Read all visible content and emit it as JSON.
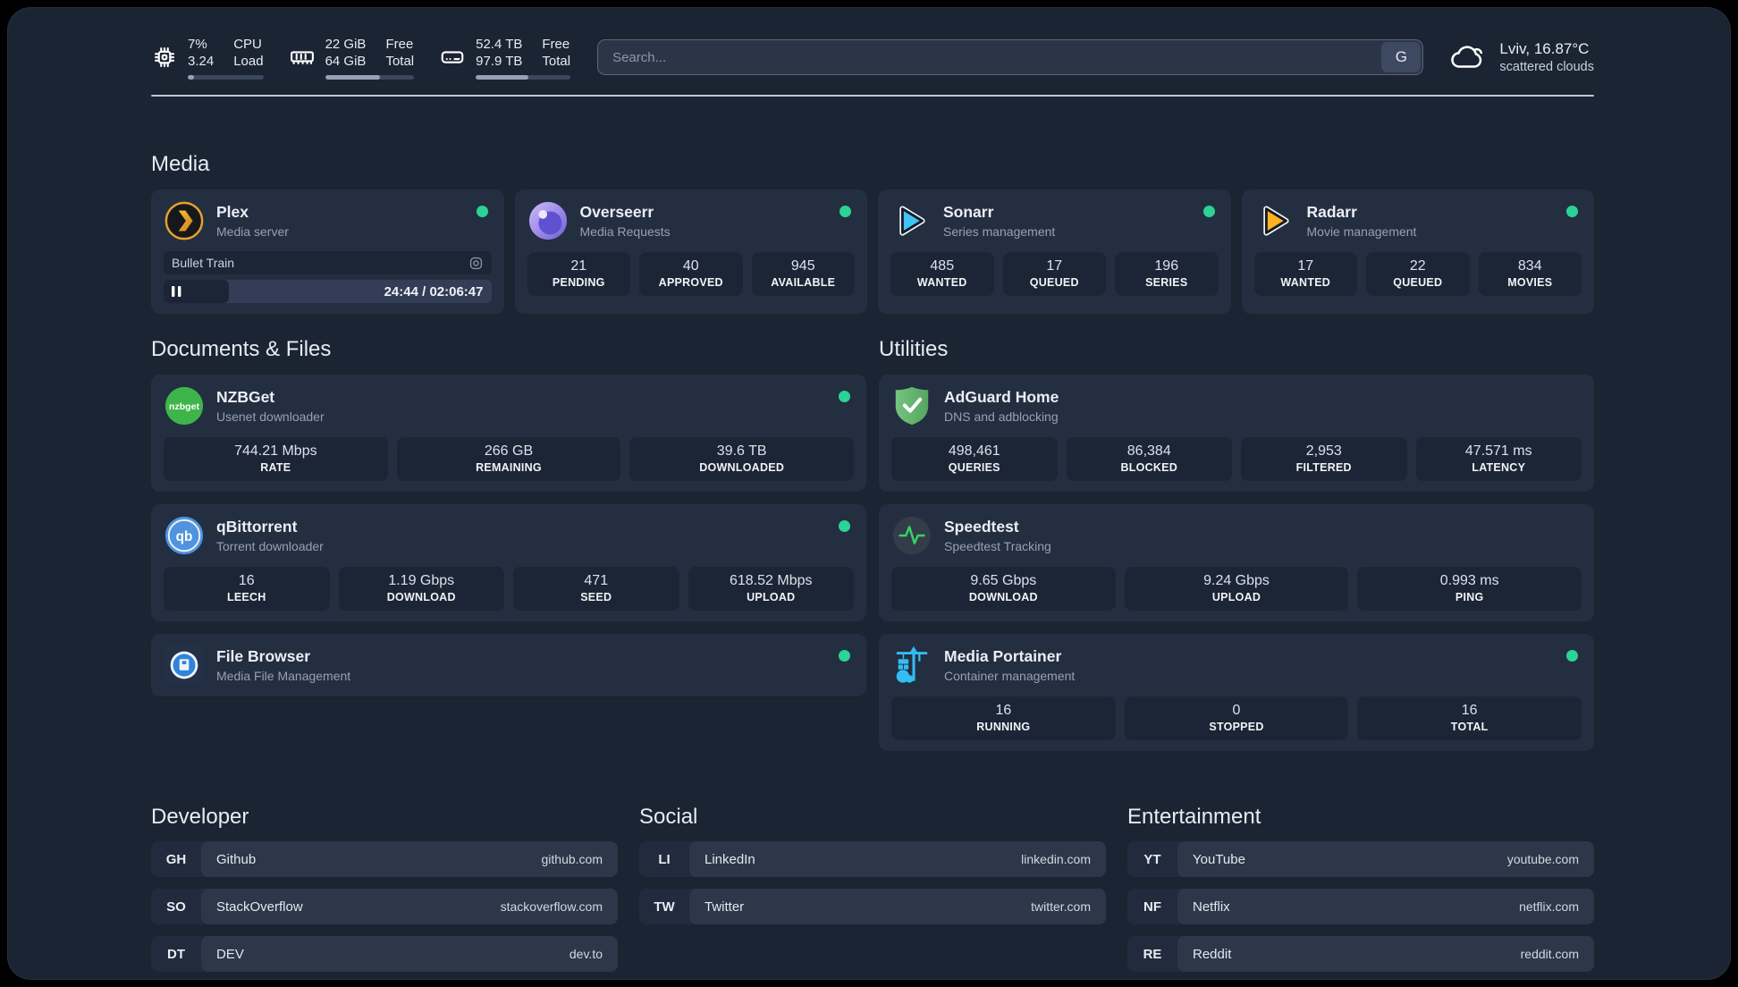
{
  "topbar": {
    "resources": [
      {
        "kind": "cpu",
        "value_top": "7%",
        "value_bottom": "3.24",
        "label_top": "CPU",
        "label_bottom": "Load",
        "progress_width": "8%"
      },
      {
        "kind": "memory",
        "value_top": "22 GiB",
        "value_bottom": "64 GiB",
        "label_top": "Free",
        "label_bottom": "Total",
        "progress_width": "62%"
      },
      {
        "kind": "disk",
        "value_top": "52.4 TB",
        "value_bottom": "97.9 TB",
        "label_top": "Free",
        "label_bottom": "Total",
        "progress_width": "56%"
      }
    ],
    "search": {
      "placeholder": "Search...",
      "provider_label": "G"
    },
    "weather": {
      "location_temp": "Lviv, 16.87°C",
      "condition": "scattered clouds"
    }
  },
  "groups": {
    "media": {
      "title": "Media",
      "services": [
        {
          "name": "Plex",
          "description": "Media server",
          "status": "online",
          "now_playing": {
            "title": "Bullet Train",
            "time_display": "24:44 / 02:06:47",
            "progress_width": "20%"
          }
        },
        {
          "name": "Overseerr",
          "description": "Media Requests",
          "status": "online",
          "stats": [
            {
              "value": "21",
              "label": "PENDING"
            },
            {
              "value": "40",
              "label": "APPROVED"
            },
            {
              "value": "945",
              "label": "AVAILABLE"
            }
          ]
        },
        {
          "name": "Sonarr",
          "description": "Series management",
          "status": "online",
          "stats": [
            {
              "value": "485",
              "label": "WANTED"
            },
            {
              "value": "17",
              "label": "QUEUED"
            },
            {
              "value": "196",
              "label": "SERIES"
            }
          ]
        },
        {
          "name": "Radarr",
          "description": "Movie management",
          "status": "online",
          "stats": [
            {
              "value": "17",
              "label": "WANTED"
            },
            {
              "value": "22",
              "label": "QUEUED"
            },
            {
              "value": "834",
              "label": "MOVIES"
            }
          ]
        }
      ]
    },
    "documents": {
      "title": "Documents & Files",
      "services": [
        {
          "name": "NZBGet",
          "description": "Usenet downloader",
          "status": "online",
          "stats": [
            {
              "value": "744.21 Mbps",
              "label": "RATE"
            },
            {
              "value": "266 GB",
              "label": "REMAINING"
            },
            {
              "value": "39.6 TB",
              "label": "DOWNLOADED"
            }
          ]
        },
        {
          "name": "qBittorrent",
          "description": "Torrent downloader",
          "status": "online",
          "stats": [
            {
              "value": "16",
              "label": "LEECH"
            },
            {
              "value": "1.19 Gbps",
              "label": "DOWNLOAD"
            },
            {
              "value": "471",
              "label": "SEED"
            },
            {
              "value": "618.52 Mbps",
              "label": "UPLOAD"
            }
          ]
        },
        {
          "name": "File Browser",
          "description": "Media File Management",
          "status": "online",
          "stats": []
        }
      ]
    },
    "utilities": {
      "title": "Utilities",
      "services": [
        {
          "name": "AdGuard Home",
          "description": "DNS and adblocking",
          "stats": [
            {
              "value": "498,461",
              "label": "QUERIES"
            },
            {
              "value": "86,384",
              "label": "BLOCKED"
            },
            {
              "value": "2,953",
              "label": "FILTERED"
            },
            {
              "value": "47.571 ms",
              "label": "LATENCY"
            }
          ]
        },
        {
          "name": "Speedtest",
          "description": "Speedtest Tracking",
          "stats": [
            {
              "value": "9.65 Gbps",
              "label": "DOWNLOAD"
            },
            {
              "value": "9.24 Gbps",
              "label": "UPLOAD"
            },
            {
              "value": "0.993 ms",
              "label": "PING"
            }
          ]
        },
        {
          "name": "Media Portainer",
          "description": "Container management",
          "status": "online",
          "stats": [
            {
              "value": "16",
              "label": "RUNNING"
            },
            {
              "value": "0",
              "label": "STOPPED"
            },
            {
              "value": "16",
              "label": "TOTAL"
            }
          ]
        }
      ]
    }
  },
  "bookmarks": [
    {
      "title": "Developer",
      "items": [
        {
          "abbr": "GH",
          "name": "Github",
          "url": "github.com"
        },
        {
          "abbr": "SO",
          "name": "StackOverflow",
          "url": "stackoverflow.com"
        },
        {
          "abbr": "DT",
          "name": "DEV",
          "url": "dev.to"
        }
      ]
    },
    {
      "title": "Social",
      "items": [
        {
          "abbr": "LI",
          "name": "LinkedIn",
          "url": "linkedin.com"
        },
        {
          "abbr": "TW",
          "name": "Twitter",
          "url": "twitter.com"
        }
      ]
    },
    {
      "title": "Entertainment",
      "items": [
        {
          "abbr": "YT",
          "name": "YouTube",
          "url": "youtube.com"
        },
        {
          "abbr": "NF",
          "name": "Netflix",
          "url": "netflix.com"
        },
        {
          "abbr": "RE",
          "name": "Reddit",
          "url": "reddit.com"
        }
      ]
    }
  ],
  "colors": {
    "status_online": "#2bd394",
    "progress_fill": "#97a1b5",
    "accent_border": "#5b6579"
  }
}
